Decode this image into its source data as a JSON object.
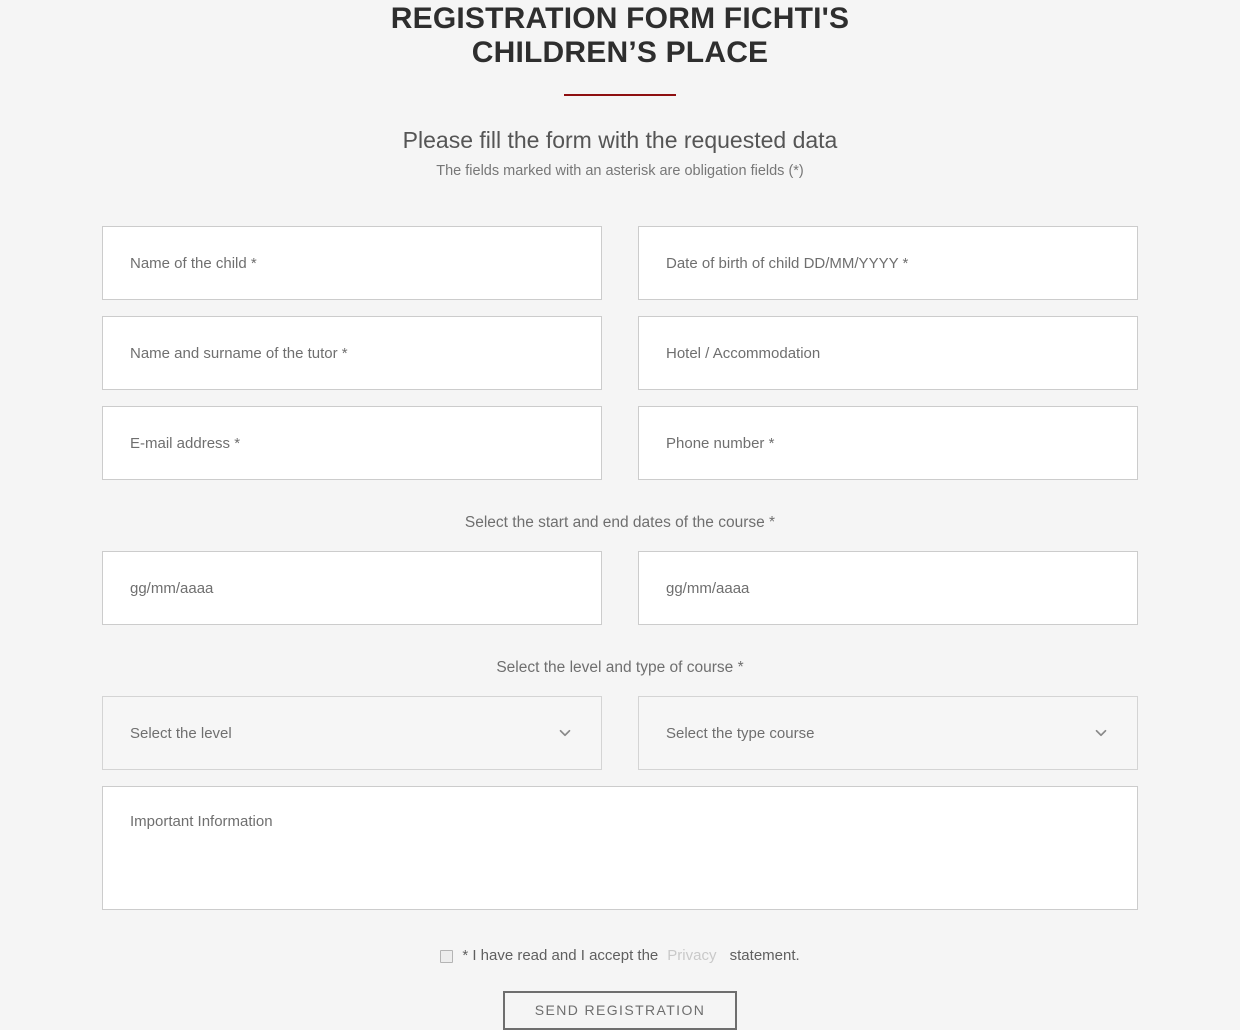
{
  "header": {
    "title": "REGISTRATION FORM FICHTI'S CHILDREN’S PLACE",
    "divider_color": "#8e0f10",
    "subtitle": "Please fill the form with the requested data",
    "note": "The fields marked with an asterisk are obligation fields (*)"
  },
  "form": {
    "rows": [
      {
        "left": {
          "placeholder": "Name of the child *"
        },
        "right": {
          "placeholder": "Date of birth of child DD/MM/YYYY *"
        }
      },
      {
        "left": {
          "placeholder": "Name and surname of the tutor *"
        },
        "right": {
          "placeholder": "Hotel / Accommodation"
        }
      },
      {
        "left": {
          "placeholder": "E-mail address *"
        },
        "right": {
          "placeholder": "Phone number *"
        }
      }
    ],
    "dates": {
      "label": "Select the start and end dates of the course *",
      "start_placeholder": "gg/mm/aaaa",
      "end_placeholder": "gg/mm/aaaa"
    },
    "course": {
      "label": "Select the level and type of course *",
      "level_placeholder": "Select the level",
      "type_placeholder": "Select the type course"
    },
    "notes": {
      "placeholder": "Important Information"
    },
    "consent": {
      "prefix": "* I have read and I accept the",
      "link": "Privacy",
      "suffix": " statement."
    },
    "submit_label": "SEND REGISTRATION"
  }
}
